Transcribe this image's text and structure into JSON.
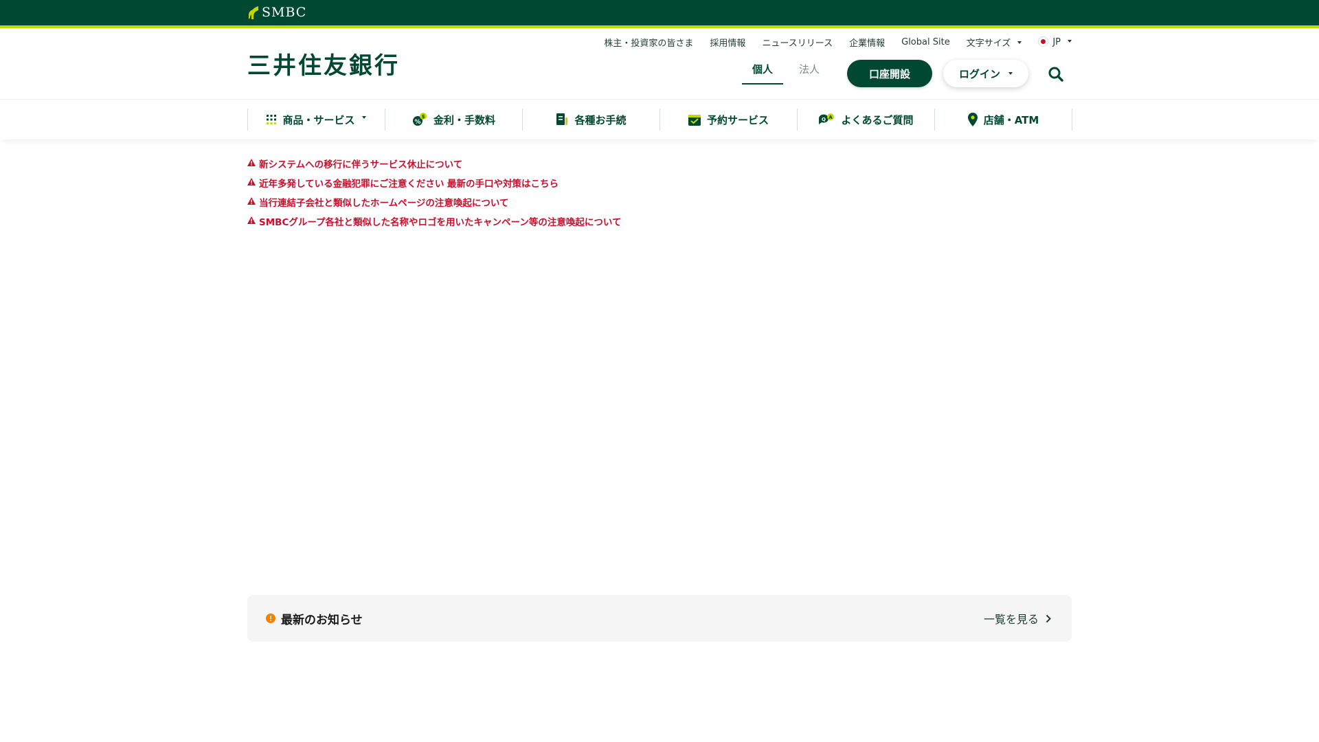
{
  "brand": {
    "logo_text": "SMBC",
    "bank_name": "三井住友銀行"
  },
  "utility_links": [
    {
      "label": "株主・投資家の皆さま"
    },
    {
      "label": "採用情報"
    },
    {
      "label": "ニュースリリース"
    },
    {
      "label": "企業情報"
    },
    {
      "label": "Global Site"
    },
    {
      "label": "文字サイズ"
    },
    {
      "label": "JP"
    }
  ],
  "segments": [
    {
      "label": "個人"
    },
    {
      "label": "法人"
    }
  ],
  "header_buttons": {
    "open_account": "口座開設",
    "login": "ログイン"
  },
  "nav": [
    {
      "label": "商品・サービス"
    },
    {
      "label": "金利・手数料"
    },
    {
      "label": "各種お手続"
    },
    {
      "label": "予約サービス"
    },
    {
      "label": "よくあるご質問"
    },
    {
      "label": "店舗・ATM"
    }
  ],
  "alerts": [
    {
      "text": "新システムへの移行に伴うサービス休止について"
    },
    {
      "text": "近年多発している金融犯罪にご注意ください 最新の手口や対策はこちら"
    },
    {
      "text": "当行連結子会社と類似したホームページの注意喚起について"
    },
    {
      "text": "SMBCグループ各社と類似した名称やロゴを用いたキャンペーン等の注意喚起について"
    }
  ],
  "news": {
    "title": "最新のお知らせ",
    "link": "一覧を見る"
  },
  "colors": {
    "primary": "#004831",
    "accent": "#c4d700",
    "alert": "#c8102e",
    "news_icon": "#f08300"
  }
}
